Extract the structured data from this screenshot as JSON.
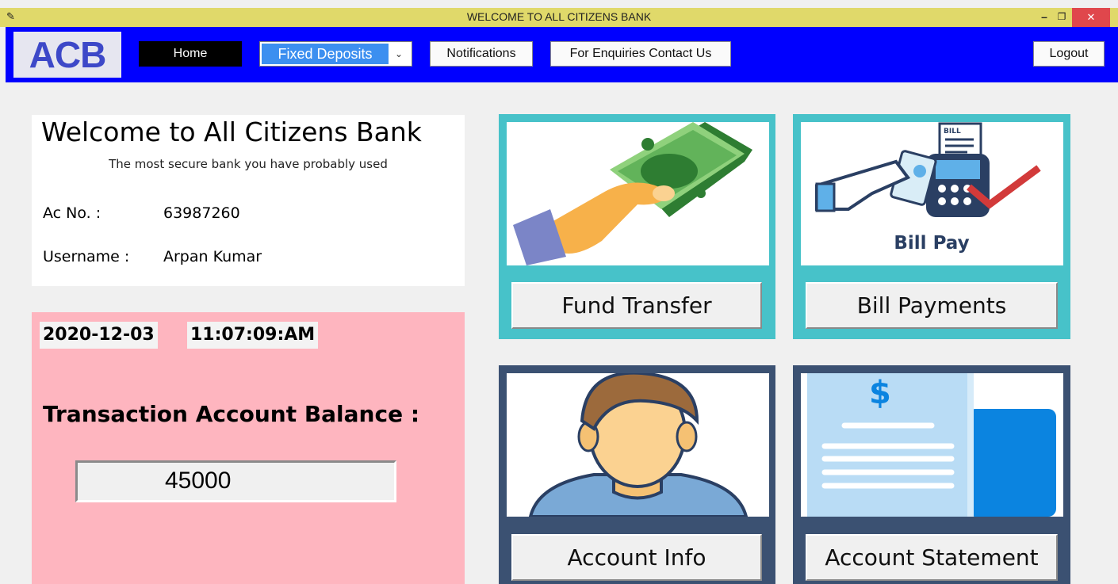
{
  "window": {
    "title": "WELCOME TO ALL CITIZENS BANK",
    "app_icon": "feather-icon",
    "minimize_glyph": "–",
    "maximize_glyph": "❐",
    "close_glyph": "✕"
  },
  "nav": {
    "logo_text": "ACB",
    "home": "Home",
    "fixed_deposits": "Fixed Deposits",
    "dropdown_arrow": "⌄",
    "notifications": "Notifications",
    "enquiries": "For Enquiries Contact Us",
    "logout": "Logout"
  },
  "welcome": {
    "title": "Welcome to All Citizens Bank",
    "subtitle": "The most secure bank you have probably used",
    "ac_label": "Ac No. :",
    "ac_value": "63987260",
    "user_label": "Username :",
    "user_value": "Arpan Kumar"
  },
  "balance": {
    "date": "2020-12-03",
    "time": "11:07:09:AM",
    "label": "Transaction Account Balance :",
    "value": "45000"
  },
  "tiles": {
    "fund_transfer": "Fund Transfer",
    "bill_payments": "Bill Payments",
    "bill_pay_caption": "Bill Pay",
    "bill_receipt_label": "BILL",
    "account_info": "Account Info",
    "account_statement": "Account Statement"
  },
  "colors": {
    "titlebar": "#e0d96a",
    "navbar": "#0000ff",
    "balance_panel": "#feb5bf",
    "tile_teal": "#47c2c9",
    "tile_navy": "#3b5172",
    "close_button": "#e0474c"
  }
}
